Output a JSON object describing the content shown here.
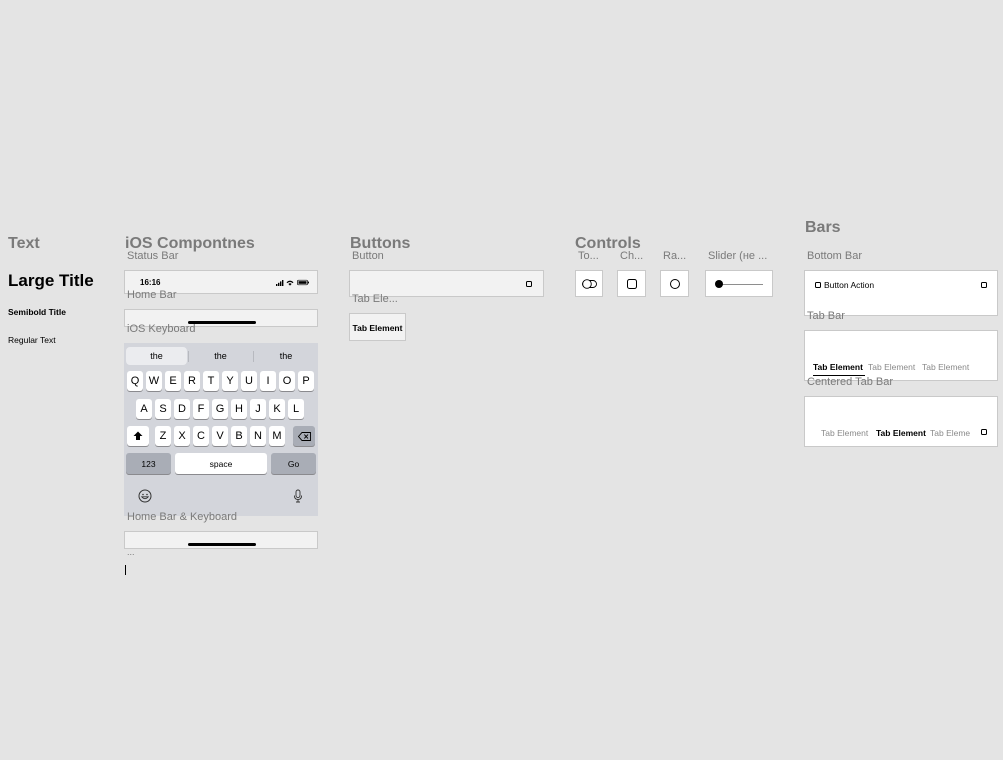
{
  "text_section": {
    "title": "Text",
    "large_title": "Large Title",
    "semibold_title": "Semibold Title",
    "regular_text": "Regular Text"
  },
  "ios_section": {
    "title": "iOS Compontnes",
    "status_bar": {
      "label": "Status Bar",
      "time": "16:16"
    },
    "home_bar": {
      "label": "Home Bar"
    },
    "keyboard": {
      "label": "iOS Keyboard",
      "suggestions": [
        "the",
        "the",
        "the"
      ],
      "row1": [
        "Q",
        "W",
        "E",
        "R",
        "T",
        "Y",
        "U",
        "I",
        "O",
        "P"
      ],
      "row2": [
        "A",
        "S",
        "D",
        "F",
        "G",
        "H",
        "J",
        "K",
        "L"
      ],
      "row3": [
        "Z",
        "X",
        "C",
        "V",
        "B",
        "N",
        "M"
      ],
      "numbers_key": "123",
      "space_key": "space",
      "go_key": "Go"
    },
    "home_bar_keyboard": {
      "label": "Home Bar & Keyboard"
    },
    "ellipsis_label": "..."
  },
  "buttons_section": {
    "title": "Buttons",
    "button_label": "Button",
    "tab_element_label": "Tab Ele...",
    "tab_element_text": "Tab Element"
  },
  "controls_section": {
    "title": "Controls",
    "toggle_label": "To...",
    "checkbox_label": "Ch...",
    "radio_label": "Ra...",
    "slider_label": "Slider (не ..."
  },
  "bars_section": {
    "title": "Bars",
    "bottom_bar": {
      "label": "Bottom Bar",
      "action": "Button Action"
    },
    "tab_bar": {
      "label": "Tab Bar",
      "tabs": [
        "Tab Element",
        "Tab Element",
        "Tab Element"
      ]
    },
    "centered_tab_bar": {
      "label": "Centered Tab Bar",
      "tabs": [
        "Tab Element",
        "Tab Element",
        "Tab Eleme"
      ]
    }
  }
}
